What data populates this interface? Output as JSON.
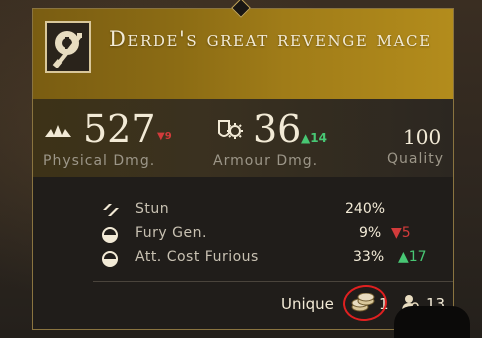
{
  "item": {
    "name": "Derde's great revenge mace",
    "icon": "mace-icon"
  },
  "stats": {
    "physical": {
      "value": "527",
      "delta": "▼9",
      "label": "Physical Dmg.",
      "icon": "burst-icon"
    },
    "armour": {
      "value": "36",
      "delta": "▲14",
      "label": "Armour Dmg.",
      "icon": "shield-gear-icon"
    },
    "quality": {
      "value": "100",
      "label": "Quality"
    }
  },
  "attributes": [
    {
      "label": "Stun",
      "value": "240%",
      "delta": "",
      "icon": "stun-icon"
    },
    {
      "label": "Fury Gen.",
      "value": "9%",
      "delta": "▼5",
      "icon": "half-circle-icon"
    },
    {
      "label": "Att. Cost Furious",
      "value": "33%",
      "delta": "▲17",
      "icon": "half-circle-icon"
    }
  ],
  "footer": {
    "rarity": "Unique",
    "price": "1",
    "price_icon": "coins-icon",
    "level": "13",
    "level_icon": "person-icon"
  },
  "colors": {
    "header_gold": "#a07c18",
    "delta_down": "#d23b3b",
    "delta_up": "#48c774",
    "annotation": "#e02020"
  }
}
